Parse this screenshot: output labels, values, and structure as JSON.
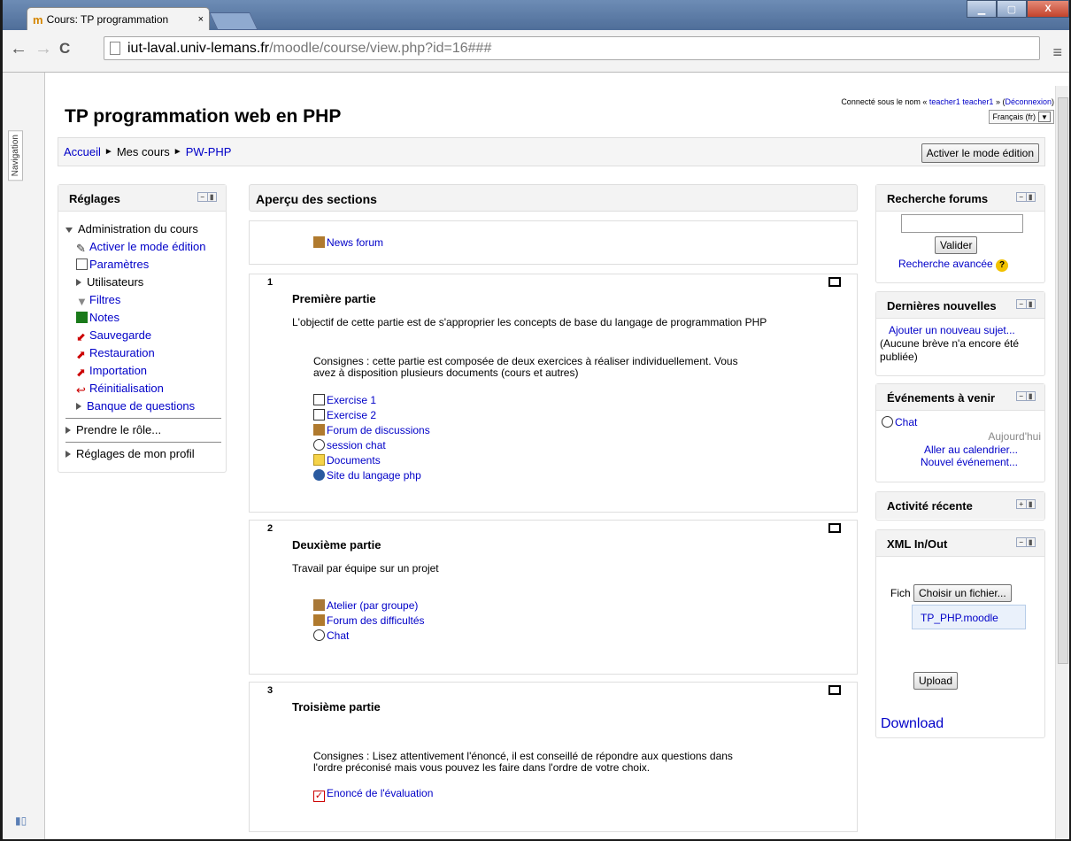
{
  "browser": {
    "tab_title": "Cours: TP programmation",
    "tab_close": "×",
    "url_host": "iut-laval.univ-lemans.fr",
    "url_path": "/moodle/course/view.php?id=16###",
    "back": "←",
    "forward": "→",
    "reload": "C",
    "menu": "≡",
    "win_min": "▁",
    "win_max": "▢",
    "win_close": "X"
  },
  "sidebar": {
    "navigation_label": "Navigation"
  },
  "header": {
    "title": "TP programmation web en PHP",
    "login_prefix": "Connecté sous le nom « ",
    "login_user": "teacher1 teacher1",
    "login_mid": " » (",
    "logout": "Déconnexion",
    "login_suffix": ")",
    "language": "Français (fr)"
  },
  "breadcrumb": {
    "home": "Accueil",
    "sep": "►",
    "mycourses": "Mes cours",
    "course": "PW-PHP",
    "edit_button": "Activer le mode édition"
  },
  "reglages": {
    "title": "Réglages",
    "admin": "Administration du cours",
    "items": [
      "Activer le mode édition",
      "Paramètres",
      "Utilisateurs",
      "Filtres",
      "Notes",
      "Sauvegarde",
      "Restauration",
      "Importation",
      "Réinitialisation",
      "Banque de questions"
    ],
    "prendre_role": "Prendre le rôle...",
    "profil": "Réglages de mon profil"
  },
  "main": {
    "title": "Aperçu des sections",
    "news": "News forum",
    "s1": {
      "num": "1",
      "title": "Première partie",
      "desc": "L'objectif de cette partie est de s'approprier les concepts de base du langage de programmation PHP",
      "consigne1": "Consignes : cette partie est composée de deux exercices à réaliser individuellement. Vous",
      "consigne2": "avez à disposition plusieurs documents (cours et autres)",
      "acts": [
        "Exercise 1",
        "Exercise 2",
        "Forum de discussions",
        "session chat",
        "Documents",
        "Site du langage php"
      ]
    },
    "s2": {
      "num": "2",
      "title": "Deuxième partie",
      "desc": "Travail par équipe sur un projet",
      "acts": [
        "Atelier (par groupe)",
        "Forum des difficultés",
        "Chat"
      ]
    },
    "s3": {
      "num": "3",
      "title": "Troisième partie",
      "consigne1": "Consignes : Lisez attentivement l'énoncé, il est conseillé de répondre aux questions dans",
      "consigne2": "l'ordre préconisé mais vous pouvez les faire dans l'ordre de votre choix.",
      "acts": [
        "Enoncé de l'évaluation"
      ]
    }
  },
  "forums": {
    "title": "Recherche forums",
    "button": "Valider",
    "advanced": "Recherche avancée"
  },
  "news": {
    "title": "Dernières nouvelles",
    "add": "Ajouter un nouveau sujet...",
    "none": "(Aucune brève n'a encore été publiée)"
  },
  "events": {
    "title": "Événements à venir",
    "chat": "Chat",
    "today": "Aujourd'hui",
    "calendar": "Aller au calendrier...",
    "new_event": "Nouvel événement..."
  },
  "activity": {
    "title": "Activité récente"
  },
  "xml": {
    "title": "XML In/Out",
    "fich": "Fich",
    "choose": "Choisir un fichier...",
    "file": "TP_PHP.moodle",
    "upload": "Upload",
    "download": "Download"
  },
  "colors": {
    "link": "#0000c8",
    "title_bar": "#5a7aa5"
  }
}
